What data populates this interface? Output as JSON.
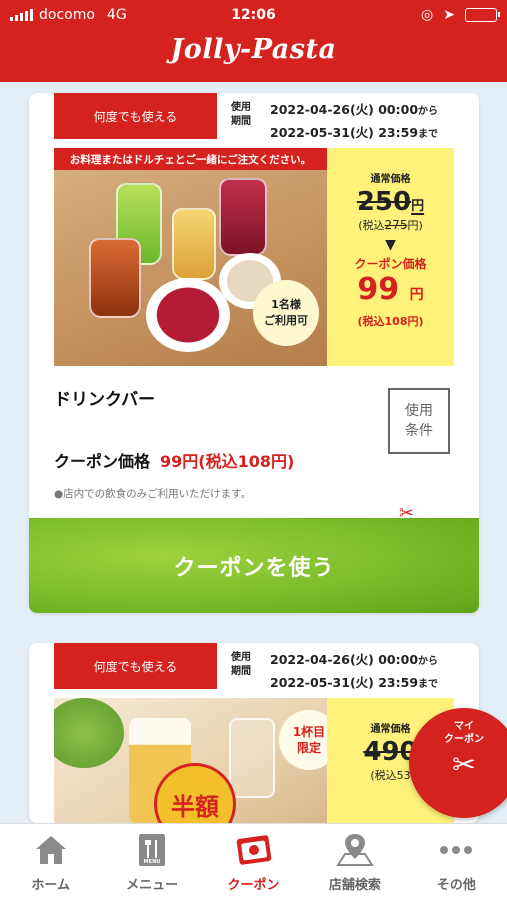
{
  "status_bar": {
    "carrier": "docomo",
    "network": "4G",
    "time": "12:06"
  },
  "header": {
    "logo": "Jolly-Pasta"
  },
  "coupons": [
    {
      "tag": "何度でも使える",
      "period_label": "使用期間",
      "period_start": "2022-04-26(火) 00:00",
      "period_start_suffix": "から",
      "period_end": "2022-05-31(火) 23:59",
      "period_end_suffix": "まで",
      "photo_banner": "お料理またはドルチェとご一緒にご注文ください。",
      "photo_badge_line1": "1名様",
      "photo_badge_line2": "ご利用可",
      "regular_label": "通常価格",
      "regular_price": "250",
      "yen": "円",
      "tax_prefix": "(税込",
      "regular_tax_price": "275",
      "tax_suffix": "円)",
      "arrow": "▼",
      "coupon_label": "クーポン価格",
      "coupon_price": "99",
      "coupon_tax": "(税込108円)",
      "name": "ドリンクバー",
      "conditions_button": "使用条件",
      "coupon_price_label": "クーポン価格",
      "coupon_price_text": "99円(税込108円)",
      "note": "●店内での飲食のみご利用いただけます。",
      "use_button": "クーポンを使う"
    },
    {
      "tag": "何度でも使える",
      "period_label": "使用期間",
      "period_start": "2022-04-26(火) 00:00",
      "period_start_suffix": "から",
      "period_end": "2022-05-31(火) 23:59",
      "period_end_suffix": "まで",
      "badge_line1": "1杯目",
      "badge_line2": "限定",
      "half_price": "半額",
      "regular_label": "通常価格",
      "regular_price": "490",
      "tax_partial": "(税込53"
    }
  ],
  "my_coupon": {
    "line1": "マイ",
    "line2": "クーポン"
  },
  "nav": [
    {
      "label": "ホーム",
      "icon": "home-icon"
    },
    {
      "label": "メニュー",
      "icon": "menu-book-icon"
    },
    {
      "label": "クーポン",
      "icon": "coupon-ticket-icon",
      "active": true
    },
    {
      "label": "店舗検索",
      "icon": "map-pin-icon"
    },
    {
      "label": "その他",
      "icon": "more-dots-icon"
    }
  ],
  "colors": {
    "brand_red": "#d6221e",
    "price_yellow": "#fff27a",
    "use_green": "#7bbb2a",
    "page_bg": "#e4eef6"
  }
}
